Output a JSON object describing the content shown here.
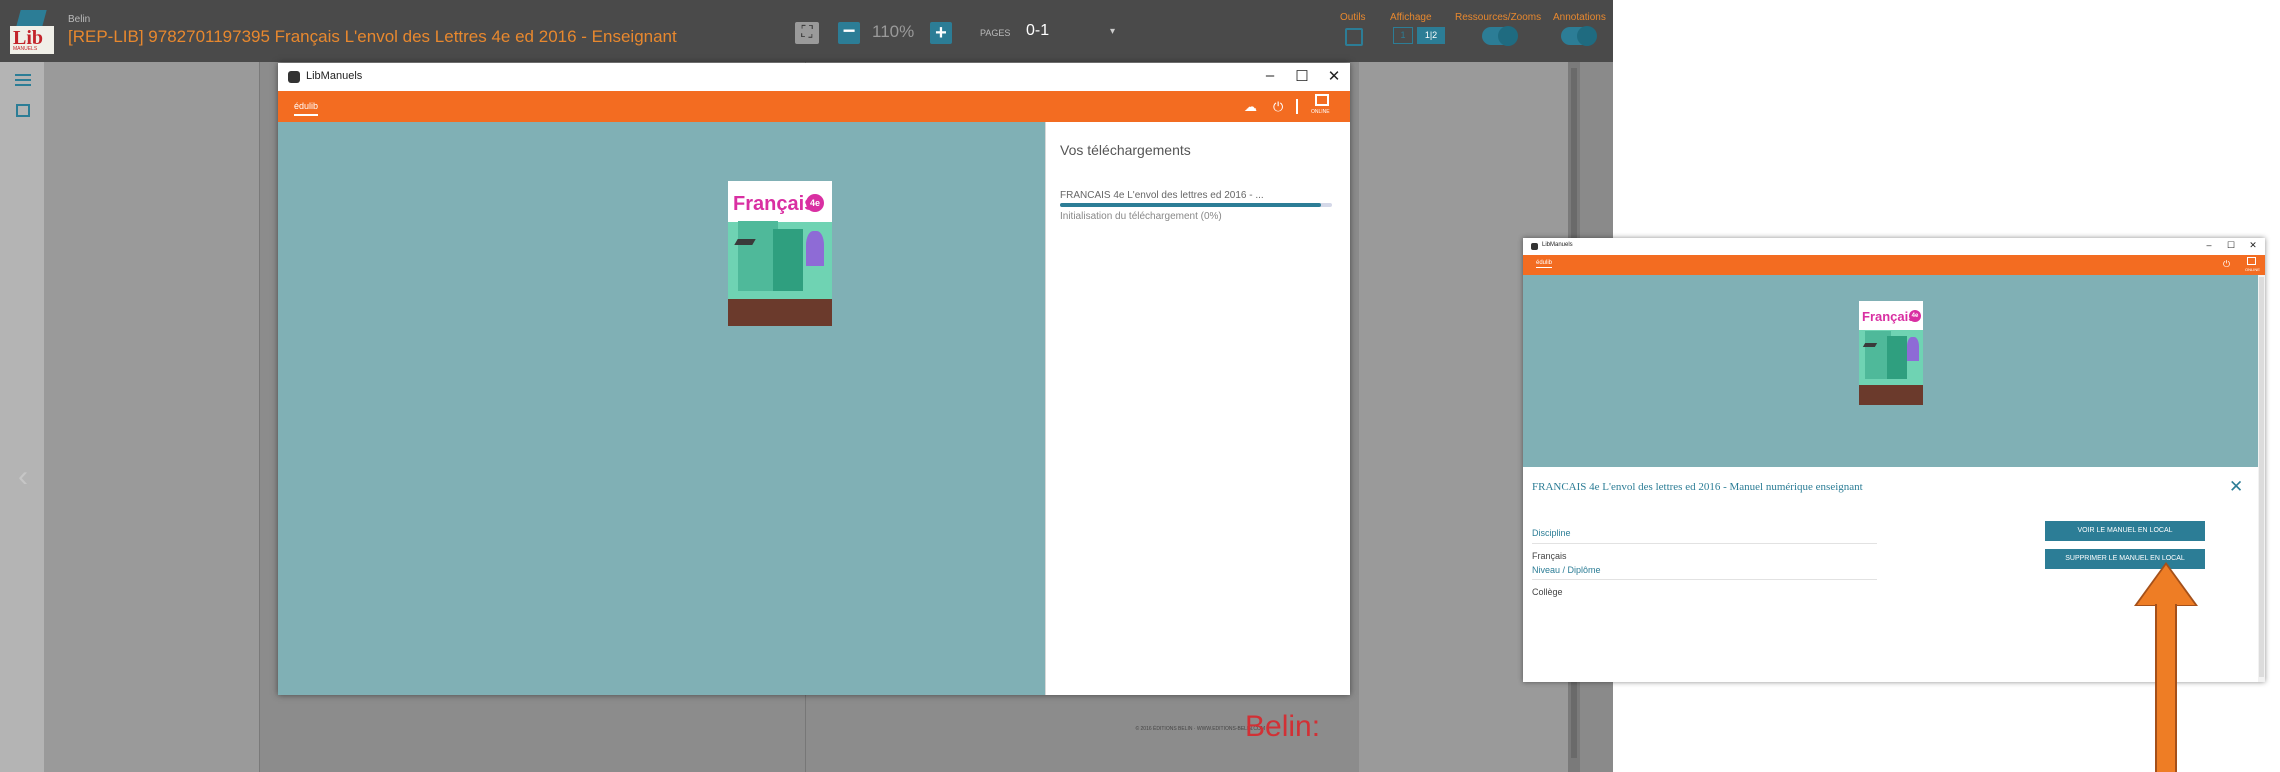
{
  "reader": {
    "logo_text": "Lib",
    "logo_sub": "MANUELS",
    "doc_kicker": "Belin",
    "doc_title": "[REP-LIB] 9782701197395 Français L'envol des Lettres 4e ed 2016 - Enseignant",
    "expand_glyph": "⛶",
    "minus_glyph": "−",
    "zoom": "110%",
    "plus_glyph": "+",
    "pages_label": "PAGES",
    "pages_value": "0-1",
    "pages_caret": "▾",
    "outils_label": "Outils",
    "affichage_label": "Affichage",
    "affichage_single": "1",
    "affichage_double": "1|2",
    "ressources_label": "Ressources/Zooms",
    "annotations_label": "Annotations",
    "prev_arrow": "‹",
    "footer_small": "© 2016 ÉDITIONS BELIN · WWW.EDITIONS-BELIN.COM",
    "footer_brand": "Belin:"
  },
  "modal": {
    "title": "LibManuels",
    "minimize": "–",
    "maximize": "☐",
    "close": "✕",
    "tab": "édulib",
    "download_glyph": "☁",
    "power_glyph": "⏻",
    "online_label": "ONLINE",
    "downloads_title": "Vos téléchargements",
    "download_item": "FRANCAIS 4e L'envol des lettres ed 2016 - ...",
    "download_progress": 0.96,
    "download_status": "Initialisation du téléchargement (0%)"
  },
  "cover": {
    "title": "Français",
    "grade": "4e",
    "series": "L'envol des lettres"
  },
  "small_window": {
    "title": "LibManuels",
    "minimize": "–",
    "maximize": "☐",
    "close": "✕",
    "tab": "édulib",
    "power_glyph": "⏻",
    "online_label": "ONLINE",
    "book_title": "FRANCAIS 4e L'envol des lettres ed 2016 - Manuel numérique enseignant",
    "panel_close": "✕",
    "discipline_label": "Discipline",
    "discipline_value": "Français",
    "niveau_label": "Niveau / Diplôme",
    "niveau_value": "Collège",
    "btn_voir": "VOIR LE MANUEL EN LOCAL",
    "btn_supprimer": "SUPPRIMER LE MANUEL EN LOCAL"
  },
  "colors": {
    "accent_teal": "#2c7d96",
    "orange": "#f36c21",
    "arrow": "#ee7d25",
    "panel_teal": "#80b0b5"
  }
}
